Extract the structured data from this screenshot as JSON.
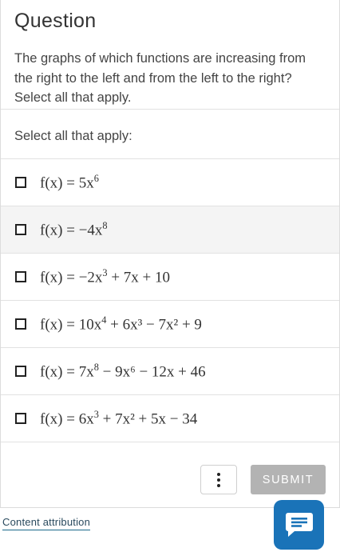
{
  "question": {
    "title": "Question",
    "text": "The graphs of which functions are increasing from the right to the left and from the left to the right? Select all that apply.",
    "instruction": "Select all that apply:"
  },
  "options": [
    {
      "lhs": "f(x) = 5x",
      "exp": "6",
      "rest": ""
    },
    {
      "lhs": "f(x) = −4x",
      "exp": "8",
      "rest": ""
    },
    {
      "lhs": "f(x) = −2x",
      "exp": "3",
      "rest": " + 7x + 10"
    },
    {
      "lhs": "f(x) = 10x",
      "exp": "4",
      "rest": " + 6x³ − 7x² + 9"
    },
    {
      "lhs": "f(x) = 7x",
      "exp": "8",
      "rest": " − 9x⁶ − 12x + 46"
    },
    {
      "lhs": "f(x) = 6x",
      "exp": "3",
      "rest": " + 7x² + 5x − 34"
    }
  ],
  "actions": {
    "submit_label": "SUBMIT",
    "more_icon": "vertical-ellipsis-icon"
  },
  "attribution": "Content attribution",
  "chat_icon": "chat-bubble-icon",
  "colors": {
    "submit_bg": "#b3b3b3",
    "chat_bg": "#1a73b8",
    "link": "#1a6a8a"
  }
}
